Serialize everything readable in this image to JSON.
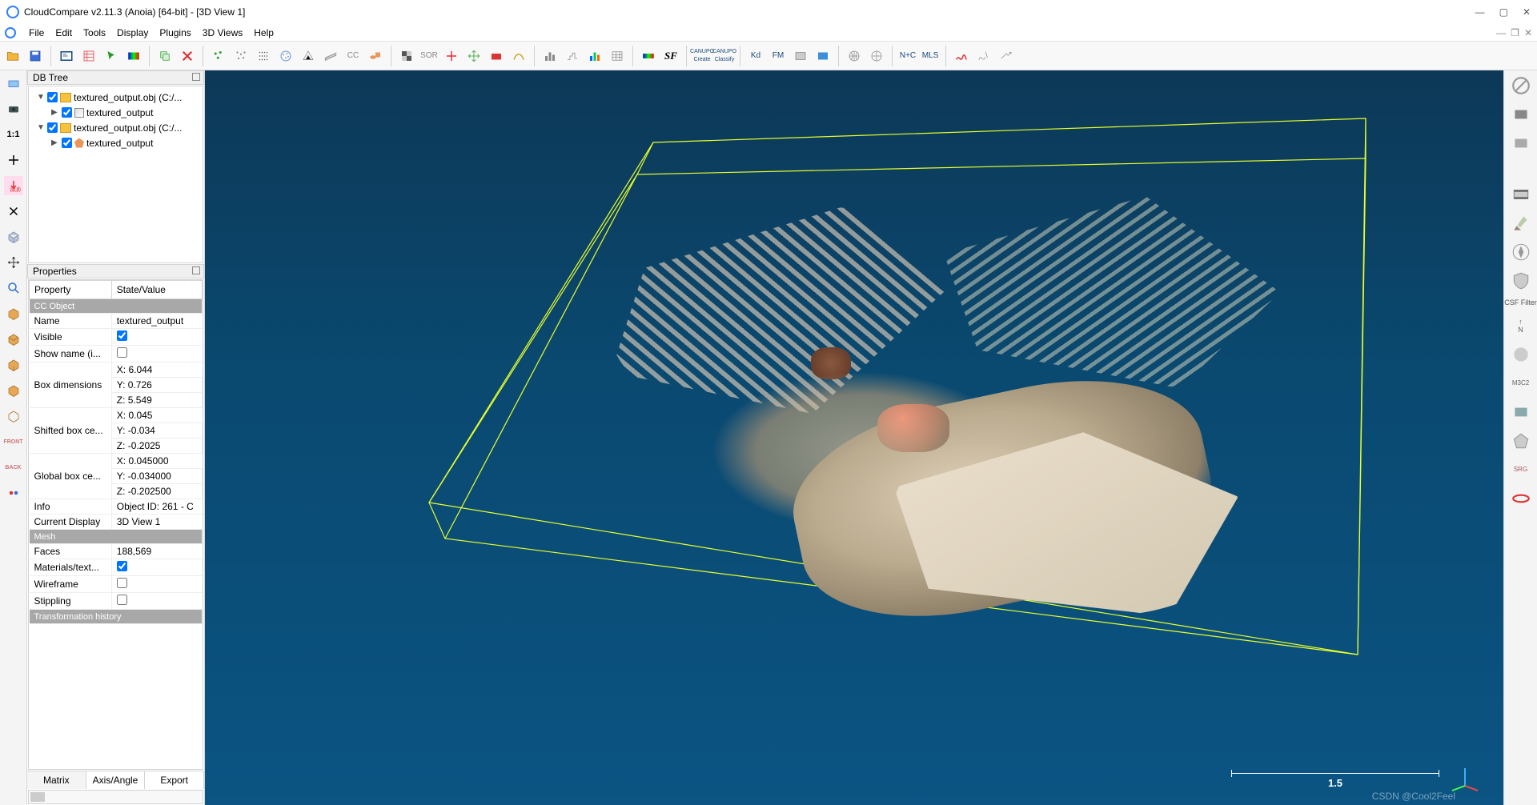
{
  "title": "CloudCompare v2.11.3 (Anoia) [64-bit] - [3D View 1]",
  "menu": [
    "File",
    "Edit",
    "Tools",
    "Display",
    "Plugins",
    "3D Views",
    "Help"
  ],
  "panels": {
    "dbtree": "DB Tree",
    "properties": "Properties"
  },
  "tree": [
    {
      "indent": 0,
      "arrow": "▼",
      "check": true,
      "icon": "f",
      "label": "textured_output.obj (C:/..."
    },
    {
      "indent": 1,
      "arrow": "▶",
      "check": true,
      "icon": "g",
      "label": "textured_output"
    },
    {
      "indent": 0,
      "arrow": "▼",
      "check": true,
      "icon": "f",
      "label": "textured_output.obj (C:/..."
    },
    {
      "indent": 1,
      "arrow": "▶",
      "check": true,
      "icon": "m",
      "label": "textured_output"
    }
  ],
  "propheaders": [
    "Property",
    "State/Value"
  ],
  "props": [
    {
      "sect": "CC Object"
    },
    {
      "k": "Name",
      "v": "textured_output"
    },
    {
      "k": "Visible",
      "chk": true
    },
    {
      "k": "Show name (i...",
      "chk": false
    },
    {
      "k": "Box dimensions",
      "v": "X: 6.044\nY: 0.726\nZ: 5.549"
    },
    {
      "k": "Shifted box ce...",
      "v": "X: 0.045\nY: -0.034\nZ: -0.2025"
    },
    {
      "k": "Global box ce...",
      "v": "X: 0.045000\nY: -0.034000\nZ: -0.202500"
    },
    {
      "k": "Info",
      "v": "Object ID: 261 - C"
    },
    {
      "k": "Current Display",
      "v": "3D View 1"
    },
    {
      "sect": "Mesh"
    },
    {
      "k": "Faces",
      "v": "188,569"
    },
    {
      "k": "Materials/text...",
      "chk": true
    },
    {
      "k": "Wireframe",
      "chk": false
    },
    {
      "k": "Stippling",
      "chk": false
    },
    {
      "sect": "Transformation history"
    }
  ],
  "tabs": [
    "Matrix",
    "Axis/Angle",
    "Export"
  ],
  "scale": "1.5",
  "watermark": "CSDN @Cool2Feel",
  "rightlabel": "CSF Filter",
  "kd": "Kd",
  "fm": "FM",
  "nc": "N+C",
  "mls": "MLS",
  "sor": "SOR",
  "tooltips": {
    "open": "Open",
    "save": "Save",
    "props": "Properties",
    "list": "List",
    "pick": "Pick",
    "colorscale": "Color Scale",
    "clone": "Clone",
    "delete": "Delete"
  }
}
